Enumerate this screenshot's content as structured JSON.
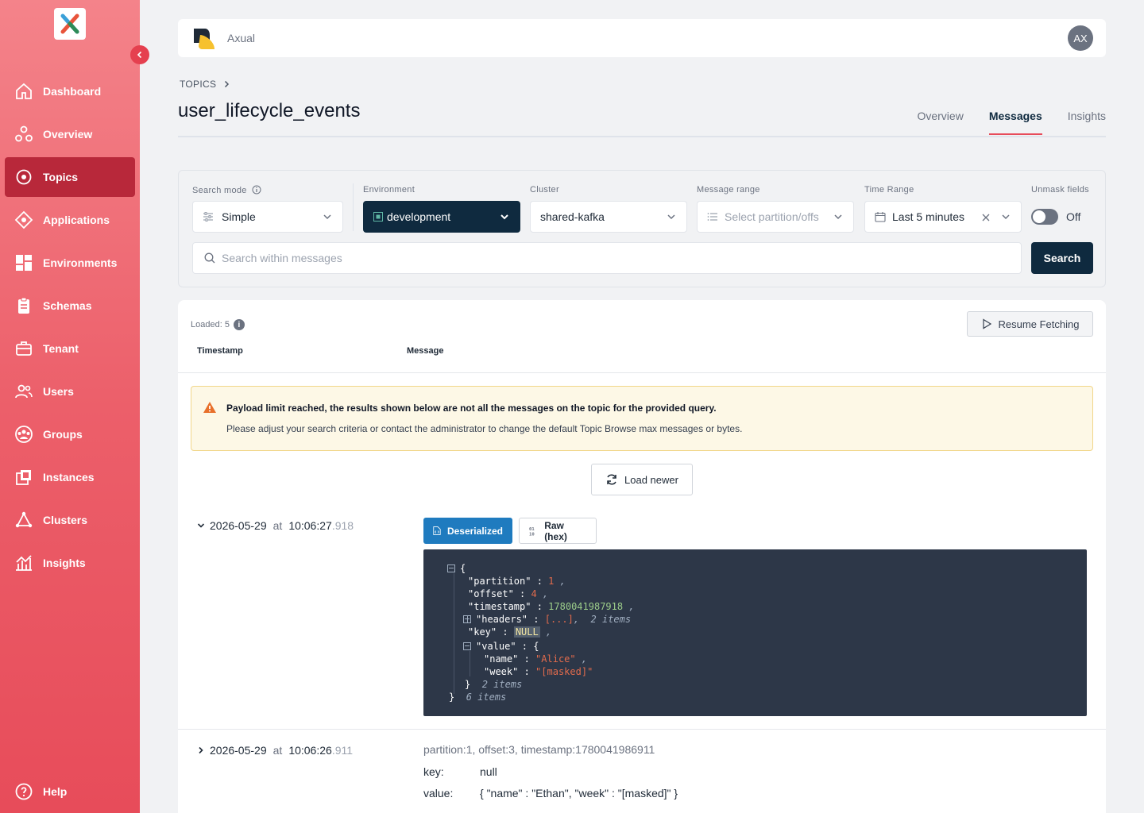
{
  "app": {
    "brand": "Axual",
    "avatar_initials": "AX",
    "logo_icon": "x-logo-icon",
    "colors": {
      "sidebar": "#ec5f6a",
      "active_nav": "#b8283a",
      "primary": "#0f2a3f",
      "accent": "#e74c5a",
      "blue": "#1f7bbf"
    }
  },
  "sidebar": {
    "items": [
      {
        "label": "Dashboard",
        "icon": "home-icon"
      },
      {
        "label": "Overview",
        "icon": "overview-icon"
      },
      {
        "label": "Topics",
        "icon": "topics-icon",
        "active": true
      },
      {
        "label": "Applications",
        "icon": "applications-icon"
      },
      {
        "label": "Environments",
        "icon": "environments-icon"
      },
      {
        "label": "Schemas",
        "icon": "schemas-icon"
      },
      {
        "label": "Tenant",
        "icon": "tenant-icon"
      },
      {
        "label": "Users",
        "icon": "users-icon"
      },
      {
        "label": "Groups",
        "icon": "groups-icon"
      },
      {
        "label": "Instances",
        "icon": "instances-icon"
      },
      {
        "label": "Clusters",
        "icon": "clusters-icon"
      },
      {
        "label": "Insights",
        "icon": "insights-icon"
      }
    ],
    "help": "Help"
  },
  "breadcrumb": "TOPICS",
  "page_title": "user_lifecycle_events",
  "tabs": [
    {
      "label": "Overview"
    },
    {
      "label": "Messages",
      "active": true
    },
    {
      "label": "Insights"
    }
  ],
  "filters": {
    "search_mode": {
      "label": "Search mode",
      "value": "Simple"
    },
    "environment": {
      "label": "Environment",
      "value": "development"
    },
    "cluster": {
      "label": "Cluster",
      "value": "shared-kafka"
    },
    "message_range": {
      "label": "Message range",
      "placeholder": "Select partition/offs"
    },
    "time_range": {
      "label": "Time Range",
      "value": "Last 5 minutes"
    },
    "unmask": {
      "label": "Unmask fields",
      "state": "Off"
    },
    "search_placeholder": "Search within messages",
    "search_button": "Search"
  },
  "messages": {
    "loaded": "Loaded: 5",
    "resume_button": "Resume Fetching",
    "col_timestamp": "Timestamp",
    "col_message": "Message",
    "warning_title": "Payload limit reached, the results shown below are not all the messages on the topic for the provided query.",
    "warning_text": "Please adjust your search criteria or contact the administrator to change the default Topic Browse max messages or bytes.",
    "load_newer": "Load newer",
    "view_deserialized": "Deserialized",
    "view_raw": "Raw (hex)",
    "first": {
      "date": "2026-05-29",
      "at": "at",
      "time": "10:06:27",
      "ms": ".918",
      "json": {
        "open_brace": "{",
        "partition_key": "\"partition\"",
        "partition_val": "1",
        "offset_key": "\"offset\"",
        "offset_val": "4",
        "timestamp_key": "\"timestamp\"",
        "timestamp_val": "1780041987918",
        "headers_key": "\"headers\"",
        "headers_val": "[...]",
        "headers_count": "2 items",
        "key_key": "\"key\"",
        "key_val": "NULL",
        "value_key": "\"value\"",
        "name_key": "\"name\"",
        "name_val": "\"Alice\"",
        "week_key": "\"week\"",
        "week_val": "\"[masked]\"",
        "value_count": "2 items",
        "close_brace": "}",
        "root_count": "6 items"
      }
    },
    "second": {
      "date": "2026-05-29",
      "at": "at",
      "time": "10:06:26",
      "ms": ".911",
      "meta": "partition:1, offset:3, timestamp:1780041986911",
      "key_label": "key:",
      "key_val": "null",
      "value_label": "value:",
      "value_val": "{ \"name\" : \"Ethan\", \"week\" : \"[masked]\" }"
    }
  }
}
